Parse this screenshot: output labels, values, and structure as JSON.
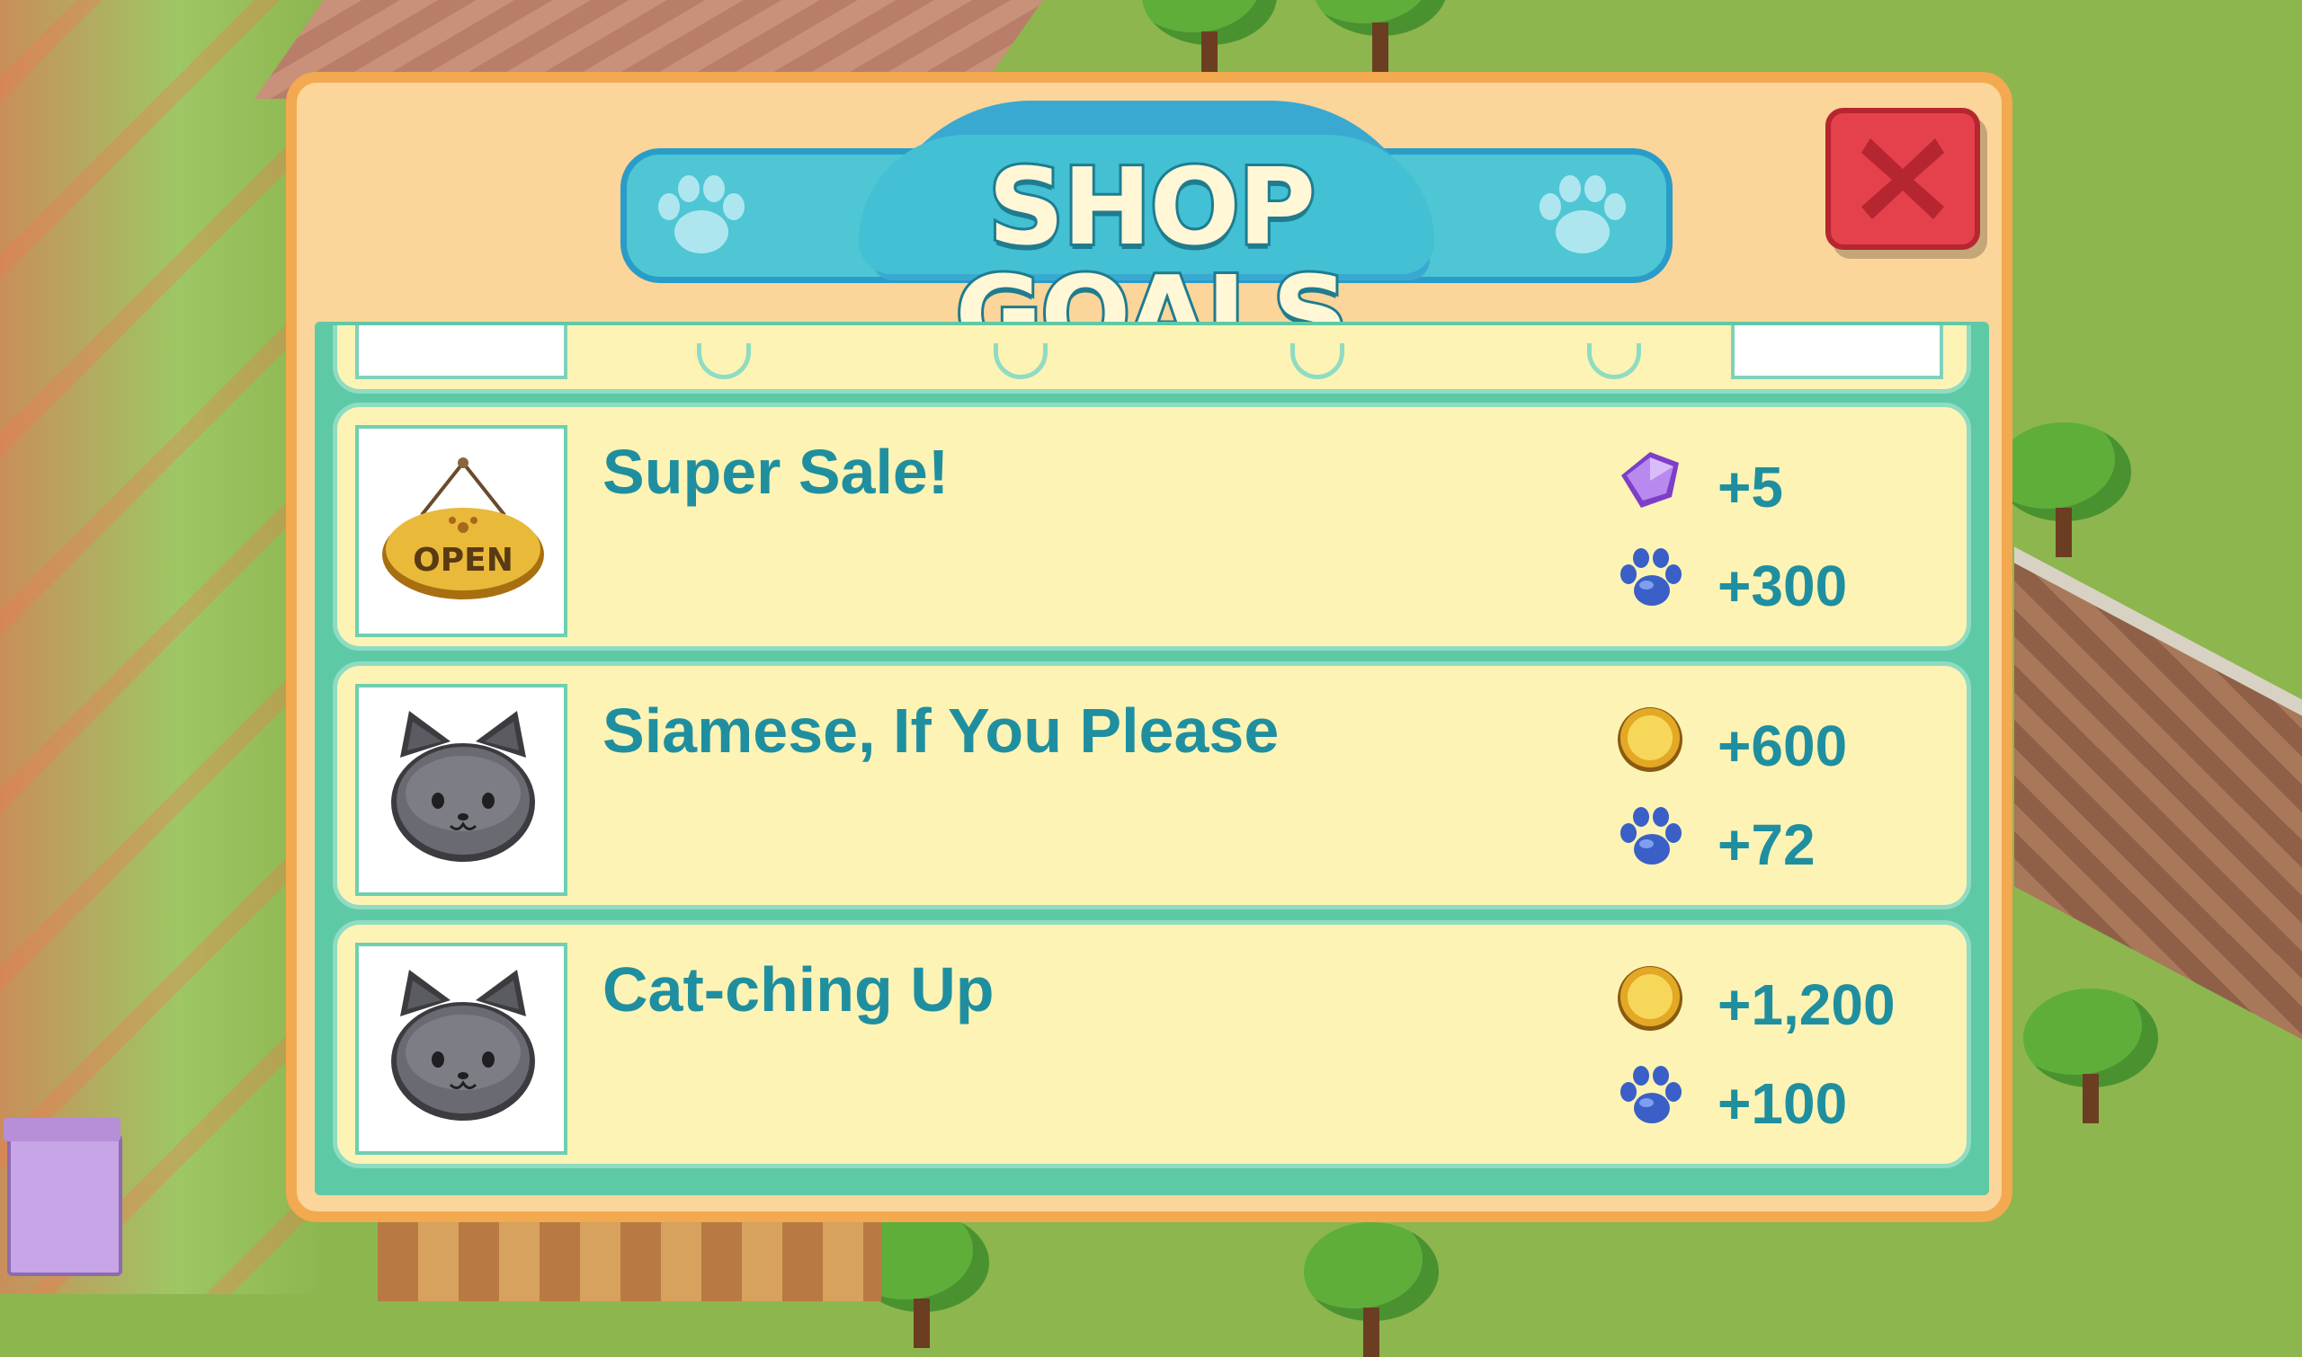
{
  "dialog": {
    "title": "SHOP GOALS",
    "close_icon": "close-x-icon"
  },
  "goals": [
    {
      "title": "Super Sale!",
      "icon": "open-sign-icon",
      "rewards": [
        {
          "icon": "gem-icon",
          "value": "+5"
        },
        {
          "icon": "paw-icon",
          "value": "+300"
        }
      ]
    },
    {
      "title": "Siamese, If You Please",
      "icon": "cat-icon",
      "rewards": [
        {
          "icon": "coin-icon",
          "value": "+600"
        },
        {
          "icon": "paw-icon",
          "value": "+72"
        }
      ]
    },
    {
      "title": "Cat-ching Up",
      "icon": "cat-icon",
      "rewards": [
        {
          "icon": "coin-icon",
          "value": "+1,200"
        },
        {
          "icon": "paw-icon",
          "value": "+100"
        }
      ]
    }
  ],
  "colors": {
    "dialog_bg": "#fbd599",
    "dialog_border": "#f2a950",
    "list_bg": "#5ec9a5",
    "row_bg": "#fdf3b4",
    "text_teal": "#1f8fa0",
    "close_red": "#e4414c"
  }
}
